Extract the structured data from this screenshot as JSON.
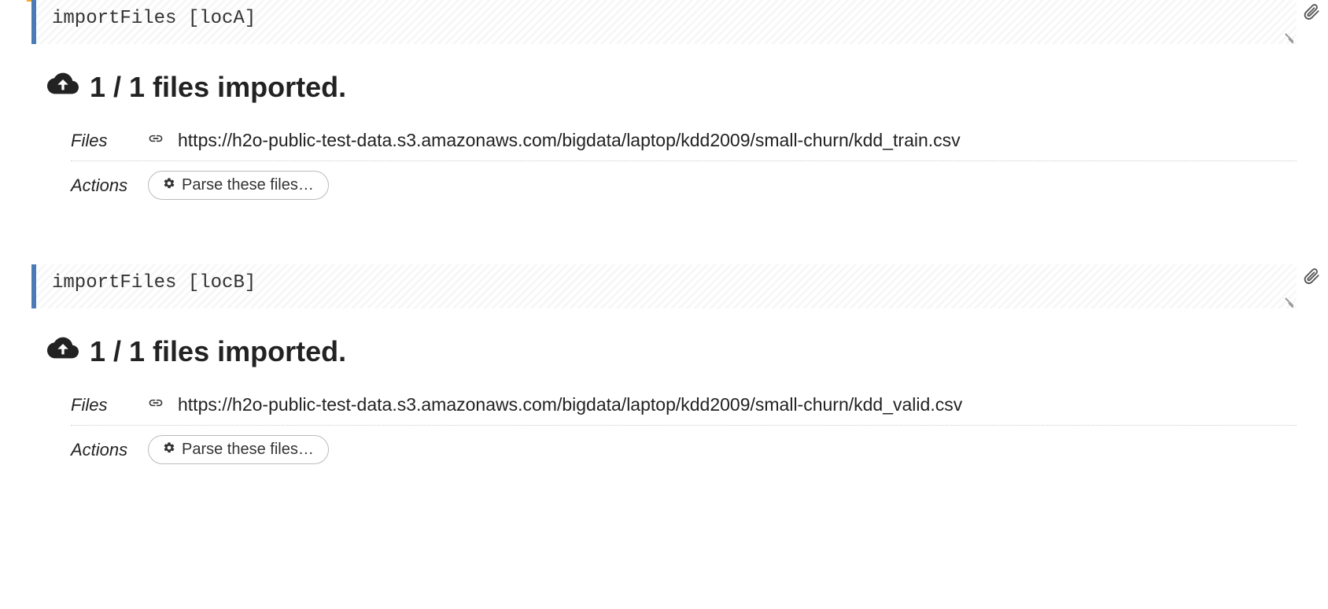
{
  "cells": [
    {
      "code": "importFiles [locA]",
      "accent": "orange",
      "heading": "1 / 1 files imported.",
      "files_label": "Files",
      "file_url": "https://h2o-public-test-data.s3.amazonaws.com/bigdata/laptop/kdd2009/small-churn/kdd_train.csv",
      "actions_label": "Actions",
      "parse_label": "Parse these files…"
    },
    {
      "code": "importFiles [locB]",
      "accent": "none",
      "heading": "1 / 1 files imported.",
      "files_label": "Files",
      "file_url": "https://h2o-public-test-data.s3.amazonaws.com/bigdata/laptop/kdd2009/small-churn/kdd_valid.csv",
      "actions_label": "Actions",
      "parse_label": "Parse these files…"
    }
  ]
}
